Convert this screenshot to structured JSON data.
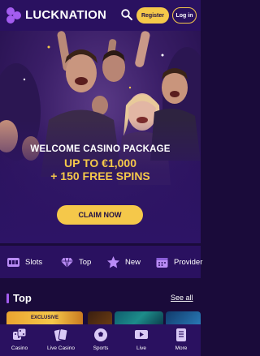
{
  "header": {
    "brand": "LUCKNATION",
    "register_label": "Register",
    "login_label": "Log in"
  },
  "hero": {
    "line1": "WELCOME CASINO PACKAGE",
    "line2": "UP TO €1,000",
    "line3": "+ 150 FREE SPINS",
    "cta_label": "CLAIM NOW"
  },
  "categories": [
    {
      "label": "Slots",
      "icon": "slot-machine-icon"
    },
    {
      "label": "Top",
      "icon": "diamond-icon"
    },
    {
      "label": "New",
      "icon": "star-icon"
    },
    {
      "label": "Provider",
      "icon": "calendar-icon"
    }
  ],
  "section": {
    "title": "Top",
    "see_all": "See all"
  },
  "games": [
    {
      "tag": "EXCLUSIVE"
    }
  ],
  "bottom_nav": [
    {
      "label": "Casino",
      "icon": "dice-icon"
    },
    {
      "label": "Live Casino",
      "icon": "cards-icon"
    },
    {
      "label": "Sports",
      "icon": "soccer-ball-icon"
    },
    {
      "label": "Live",
      "icon": "play-screen-icon"
    },
    {
      "label": "More",
      "icon": "document-icon"
    }
  ],
  "colors": {
    "accent_gold": "#f5c84a",
    "nav_purple": "#2a1160",
    "bg_purple": "#1a0b3a",
    "section_accent": "#a45cf0"
  }
}
